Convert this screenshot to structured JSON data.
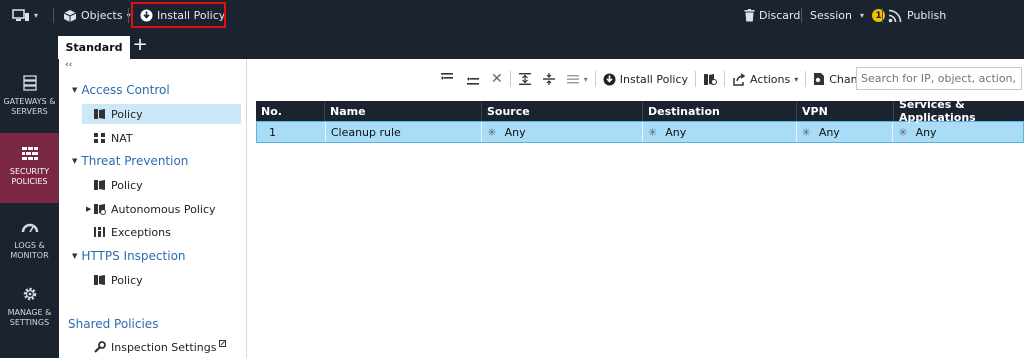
{
  "topbar": {
    "objects_label": "Objects",
    "install_policy_label": "Install Policy",
    "discard_label": "Discard",
    "session_label": "Session",
    "session_badge": "1",
    "publish_label": "Publish"
  },
  "tabs": {
    "active_label": "Standard",
    "add_label": "+"
  },
  "rail": {
    "items": [
      {
        "label": "GATEWAYS & SERVERS"
      },
      {
        "label": "SECURITY POLICIES"
      },
      {
        "label": "LOGS & MONITOR"
      },
      {
        "label": "MANAGE & SETTINGS"
      }
    ]
  },
  "tree": {
    "collapse_glyph": "‹‹",
    "access_control": {
      "label": "Access Control",
      "items": [
        "Policy",
        "NAT"
      ]
    },
    "threat_prevention": {
      "label": "Threat Prevention",
      "items": [
        "Policy",
        "Autonomous Policy",
        "Exceptions"
      ]
    },
    "https_inspection": {
      "label": "HTTPS Inspection",
      "items": [
        "Policy"
      ]
    },
    "shared_policies_label": "Shared Policies",
    "inspection_settings_label": "Inspection Settings"
  },
  "toolbar": {
    "install_policy_label": "Install Policy",
    "actions_label": "Actions",
    "changes_label": "Changes...",
    "search_placeholder": "Search for IP, object, action, ..."
  },
  "table": {
    "columns": [
      "No.",
      "Name",
      "Source",
      "Destination",
      "VPN",
      "Services & Applications"
    ],
    "rows": [
      {
        "no": "1",
        "name": "Cleanup rule",
        "source": "Any",
        "destination": "Any",
        "vpn": "Any",
        "services": "Any"
      }
    ]
  },
  "colors": {
    "dark_bg": "#1b2330",
    "active_rail": "#7a2744",
    "selected_row": "#a9dcf6",
    "link_blue": "#2b6cb0",
    "highlight_red": "#e01010"
  }
}
